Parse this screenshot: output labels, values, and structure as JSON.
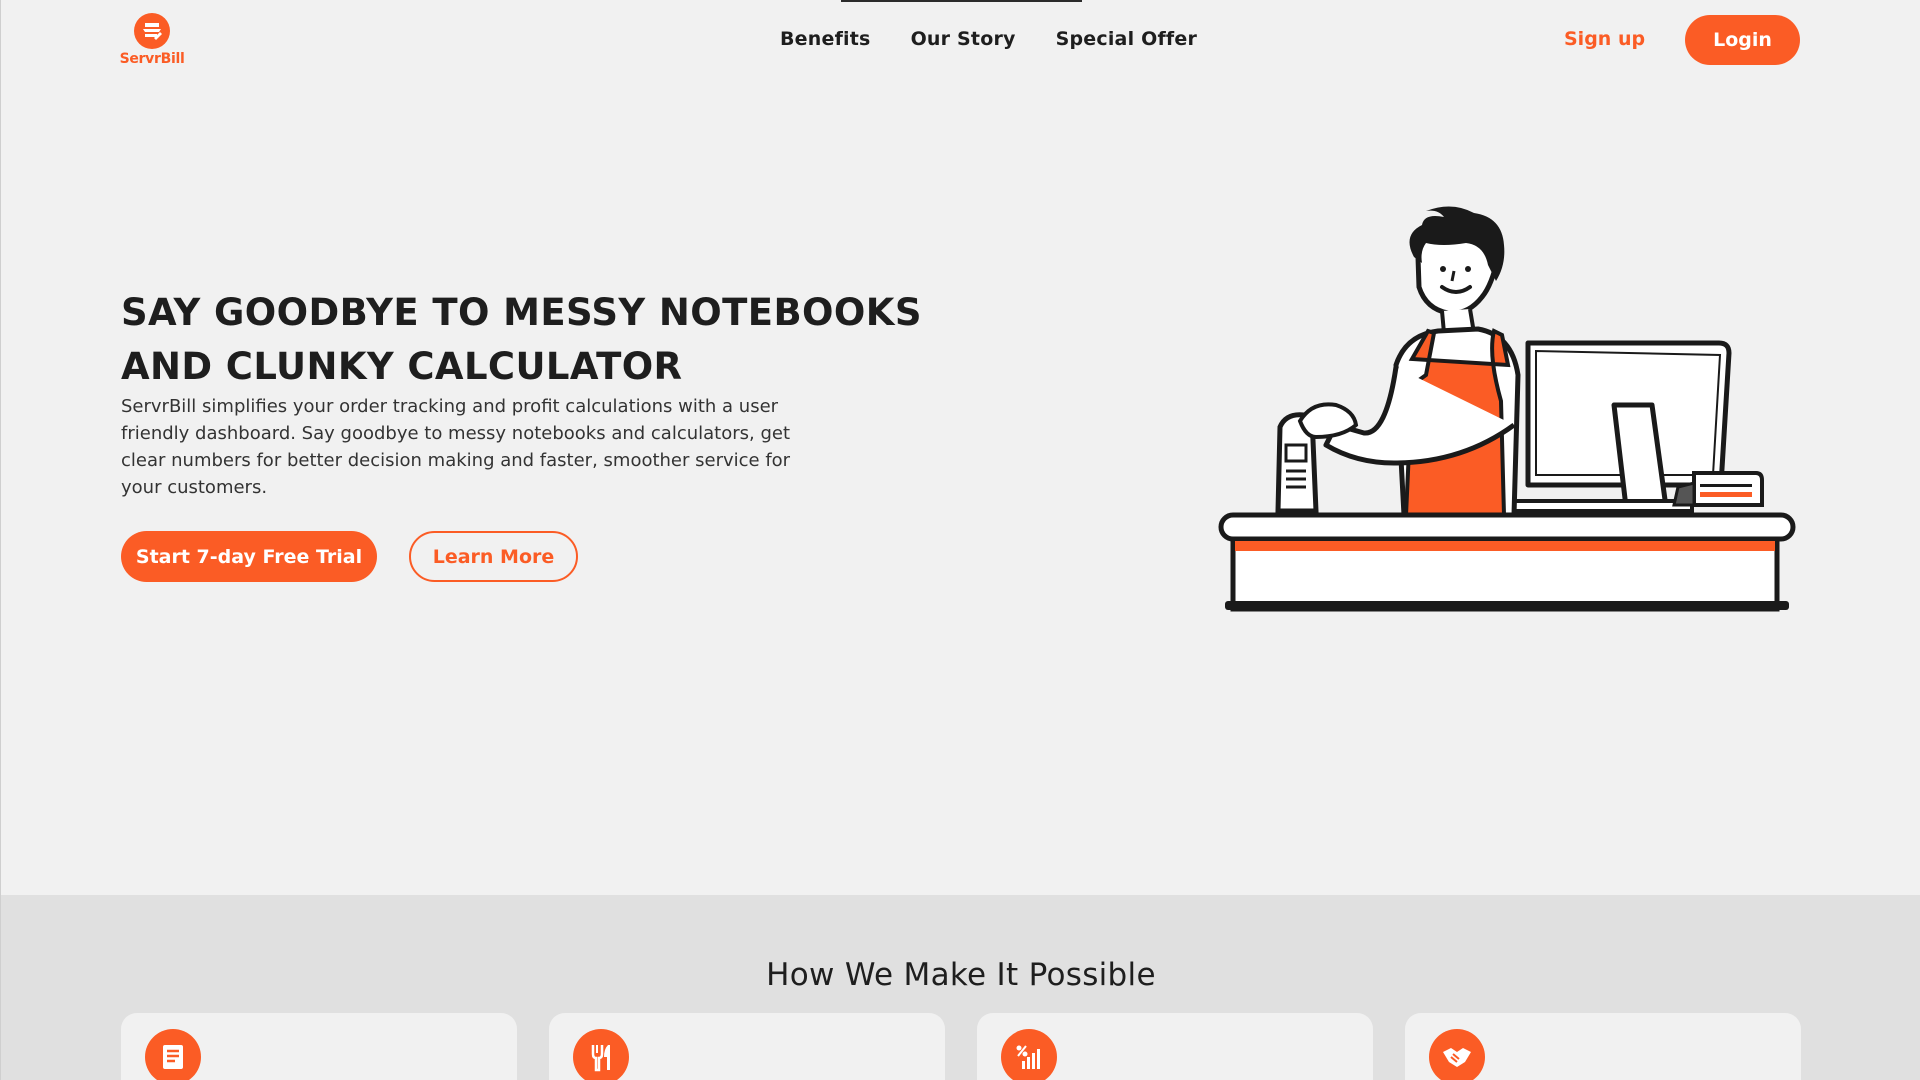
{
  "header": {
    "logo_text": "ServrBill",
    "nav": [
      "Benefits",
      "Our Story",
      "Special Offer"
    ],
    "signup_label": "Sign up",
    "login_label": "Login"
  },
  "hero": {
    "title": "SAY GOODBYE TO MESSY NOTEBOOKS AND CLUNKY CALCULATOR",
    "description": "ServrBill simplifies your order tracking and profit calculations with a user friendly dashboard. Say goodbye to messy notebooks and calculators, get clear numbers for better decision making and faster, smoother service for your customers.",
    "primary_cta": "Start 7-day Free Trial",
    "secondary_cta": "Learn More"
  },
  "features": {
    "title": "How We Make It Possible",
    "cards": [
      {
        "icon": "receipt-icon"
      },
      {
        "icon": "fork-knife-icon"
      },
      {
        "icon": "chart-percent-icon"
      },
      {
        "icon": "handshake-icon"
      }
    ]
  },
  "colors": {
    "brand": "#fb5c25",
    "background": "#f1f1f1",
    "section_background": "#e0e0e0",
    "text": "#1e1e1e"
  }
}
